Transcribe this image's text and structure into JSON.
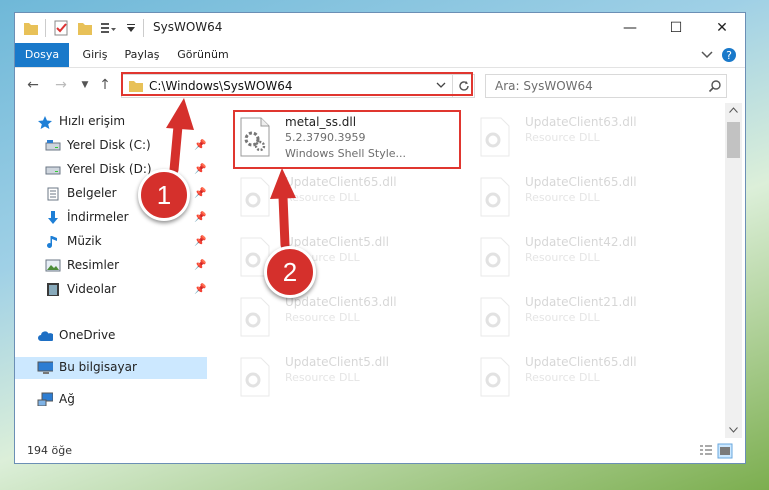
{
  "window": {
    "title": "SysWOW64"
  },
  "ribbon": {
    "tabs": [
      "Dosya",
      "Giriş",
      "Paylaş",
      "Görünüm"
    ]
  },
  "address": {
    "path": "C:\\Windows\\SysWOW64"
  },
  "search": {
    "placeholder": "Ara: SysWOW64"
  },
  "sidebar": {
    "items": [
      {
        "label": "Hızlı erişim",
        "icon": "star-icon"
      },
      {
        "label": "Yerel Disk (C:)",
        "icon": "drive-icon"
      },
      {
        "label": "Yerel Disk (D:)",
        "icon": "drive-icon"
      },
      {
        "label": "Belgeler",
        "icon": "documents-icon"
      },
      {
        "label": "İndirmeler",
        "icon": "download-icon"
      },
      {
        "label": "Müzik",
        "icon": "music-icon"
      },
      {
        "label": "Resimler",
        "icon": "pictures-icon"
      },
      {
        "label": "Videolar",
        "icon": "video-icon"
      },
      {
        "label": "OneDrive",
        "icon": "cloud-icon"
      },
      {
        "label": "Bu bilgisayar",
        "icon": "computer-icon"
      },
      {
        "label": "Ağ",
        "icon": "network-icon"
      }
    ]
  },
  "files": [
    {
      "name": "metal_ss.dll",
      "version": "5.2.3790.3959",
      "desc": "Windows Shell Style..."
    },
    {
      "name": "UpdateClient63.dll",
      "desc": "Resource DLL"
    },
    {
      "name": "UpdateClient65.dll",
      "desc": "Resource DLL"
    },
    {
      "name": "UpdateClient65.dll",
      "desc": "Resource DLL"
    },
    {
      "name": "UpdateClient5.dll",
      "desc": "Resource DLL"
    },
    {
      "name": "UpdateClient42.dll",
      "desc": "Resource DLL"
    },
    {
      "name": "UpdateClient63.dll",
      "desc": "Resource DLL"
    },
    {
      "name": "UpdateClient21.dll",
      "desc": "Resource DLL"
    },
    {
      "name": "UpdateClient5.dll",
      "desc": "Resource DLL"
    },
    {
      "name": "UpdateClient65.dll",
      "desc": "Resource DLL"
    }
  ],
  "status": {
    "count": "194 öğe"
  },
  "annotations": {
    "step1": "1",
    "step2": "2"
  },
  "colors": {
    "accent": "#1979ca",
    "highlight": "#e0362f",
    "selection": "#cce8ff"
  }
}
